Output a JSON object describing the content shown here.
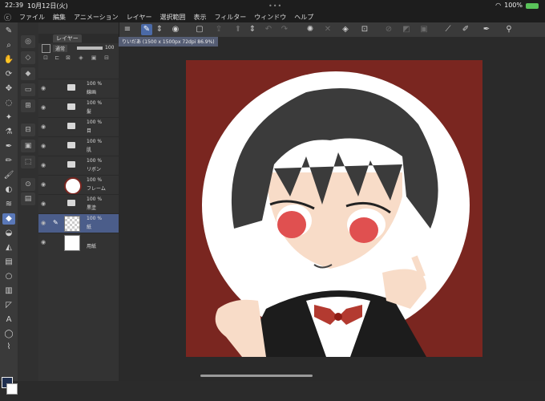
{
  "status": {
    "time": "22:39",
    "date": "10月12日(火)",
    "battery": "100%"
  },
  "menu": [
    "ファイル",
    "編集",
    "アニメーション",
    "レイヤー",
    "選択範囲",
    "表示",
    "フィルター",
    "ウィンドウ",
    "ヘルプ"
  ],
  "panel": {
    "tab_label": "レイヤー",
    "blend_mode": "通常",
    "opacity": "100"
  },
  "layers": [
    {
      "pct": "100 %",
      "name": "線画",
      "type": "folder"
    },
    {
      "pct": "100 %",
      "name": "髪",
      "type": "folder"
    },
    {
      "pct": "100 %",
      "name": "目",
      "type": "folder"
    },
    {
      "pct": "100 %",
      "name": "肌",
      "type": "folder"
    },
    {
      "pct": "100 %",
      "name": "リボン",
      "type": "folder"
    },
    {
      "pct": "100 %",
      "name": "フレーム",
      "type": "raster"
    },
    {
      "pct": "100 %",
      "name": "黒塗",
      "type": "folder"
    },
    {
      "pct": "100 %",
      "name": "紙",
      "type": "raster"
    },
    {
      "pct": "",
      "name": "用紙",
      "type": "paper"
    }
  ],
  "document": {
    "tab": "りいだあ (1500 x 1500px 72dpi 86.9%)"
  },
  "colors": {
    "background_red": "#7a2620",
    "accent": "#4b6aa8"
  }
}
